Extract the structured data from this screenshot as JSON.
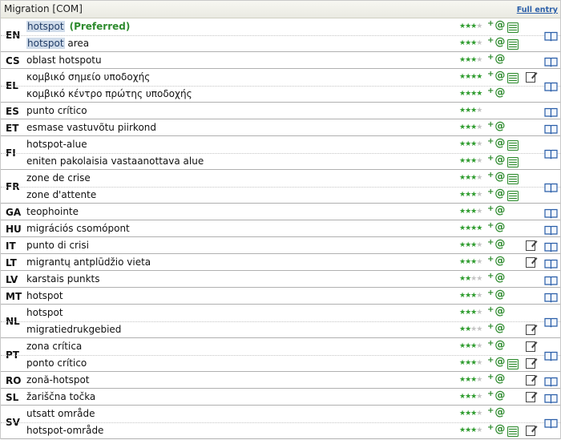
{
  "header": {
    "title": "Migration [COM]",
    "full_entry": "Full entry"
  },
  "colors": {
    "star_on": "#2e9c2e",
    "star_off": "#c4c4c4",
    "accent": "#2e8b2e",
    "link": "#2a5ea8",
    "highlight": "#d0dcea"
  },
  "groups": [
    {
      "lang": "EN",
      "terms": [
        {
          "hl": "hotspot",
          "rest": "",
          "pref": "(Preferred)",
          "stars": 3,
          "src": true,
          "note": false
        },
        {
          "hl": "hotspot",
          "rest": " area",
          "pref": "",
          "stars": 3,
          "src": true,
          "note": false
        }
      ]
    },
    {
      "lang": "CS",
      "terms": [
        {
          "hl": "",
          "rest": "oblast hotspotu",
          "pref": "",
          "stars": 3,
          "src": false,
          "note": false
        }
      ]
    },
    {
      "lang": "EL",
      "terms": [
        {
          "hl": "",
          "rest": "κομβικό σημείο υποδοχής",
          "pref": "",
          "stars": 4,
          "src": true,
          "note": true
        },
        {
          "hl": "",
          "rest": "κομβικό κέντρο πρώτης υποδοχής",
          "pref": "",
          "stars": 4,
          "src": false,
          "note": false
        }
      ]
    },
    {
      "lang": "ES",
      "terms": [
        {
          "hl": "",
          "rest": "punto crítico",
          "pref": "",
          "stars": 3,
          "src": false,
          "note": false,
          "noat": true
        }
      ]
    },
    {
      "lang": "ET",
      "terms": [
        {
          "hl": "",
          "rest": "esmase vastuvõtu piirkond",
          "pref": "",
          "stars": 3,
          "src": false,
          "note": false
        }
      ]
    },
    {
      "lang": "FI",
      "terms": [
        {
          "hl": "",
          "rest": "hotspot-alue",
          "pref": "",
          "stars": 3,
          "src": true,
          "note": false
        },
        {
          "hl": "",
          "rest": "eniten pakolaisia vastaanottava alue",
          "pref": "",
          "stars": 3,
          "src": true,
          "note": false
        }
      ]
    },
    {
      "lang": "FR",
      "terms": [
        {
          "hl": "",
          "rest": "zone de crise",
          "pref": "",
          "stars": 3,
          "src": true,
          "note": false
        },
        {
          "hl": "",
          "rest": "zone d'attente",
          "pref": "",
          "stars": 3,
          "src": true,
          "note": false
        }
      ]
    },
    {
      "lang": "GA",
      "terms": [
        {
          "hl": "",
          "rest": "teophointe",
          "pref": "",
          "stars": 3,
          "src": false,
          "note": false
        }
      ]
    },
    {
      "lang": "HU",
      "terms": [
        {
          "hl": "",
          "rest": "migrációs csomópont",
          "pref": "",
          "stars": 4,
          "src": false,
          "note": false
        }
      ]
    },
    {
      "lang": "IT",
      "terms": [
        {
          "hl": "",
          "rest": "punto di crisi",
          "pref": "",
          "stars": 3,
          "src": false,
          "note": true
        }
      ]
    },
    {
      "lang": "LT",
      "terms": [
        {
          "hl": "",
          "rest": "migrantų antplūdžio vieta",
          "pref": "",
          "stars": 3,
          "src": false,
          "note": true
        }
      ]
    },
    {
      "lang": "LV",
      "terms": [
        {
          "hl": "",
          "rest": "karstais punkts",
          "pref": "",
          "stars": 2,
          "src": false,
          "note": false
        }
      ]
    },
    {
      "lang": "MT",
      "terms": [
        {
          "hl": "",
          "rest": "hotspot",
          "pref": "",
          "stars": 3,
          "src": false,
          "note": false
        }
      ]
    },
    {
      "lang": "NL",
      "terms": [
        {
          "hl": "",
          "rest": "hotspot",
          "pref": "",
          "stars": 3,
          "src": false,
          "note": false
        },
        {
          "hl": "",
          "rest": "migratiedrukgebied",
          "pref": "",
          "stars": 2,
          "src": false,
          "note": true
        }
      ]
    },
    {
      "lang": "PT",
      "terms": [
        {
          "hl": "",
          "rest": "zona crítica",
          "pref": "",
          "stars": 3,
          "src": false,
          "note": true
        },
        {
          "hl": "",
          "rest": "ponto crítico",
          "pref": "",
          "stars": 3,
          "src": true,
          "note": true
        }
      ]
    },
    {
      "lang": "RO",
      "terms": [
        {
          "hl": "",
          "rest": "zonă-hotspot",
          "pref": "",
          "stars": 3,
          "src": false,
          "note": true
        }
      ]
    },
    {
      "lang": "SL",
      "terms": [
        {
          "hl": "",
          "rest": "žariščna točka",
          "pref": "",
          "stars": 3,
          "src": false,
          "note": true
        }
      ]
    },
    {
      "lang": "SV",
      "terms": [
        {
          "hl": "",
          "rest": "utsatt område",
          "pref": "",
          "stars": 3,
          "src": false,
          "note": false
        },
        {
          "hl": "",
          "rest": "hotspot-område",
          "pref": "",
          "stars": 3,
          "src": true,
          "note": true
        }
      ]
    }
  ]
}
